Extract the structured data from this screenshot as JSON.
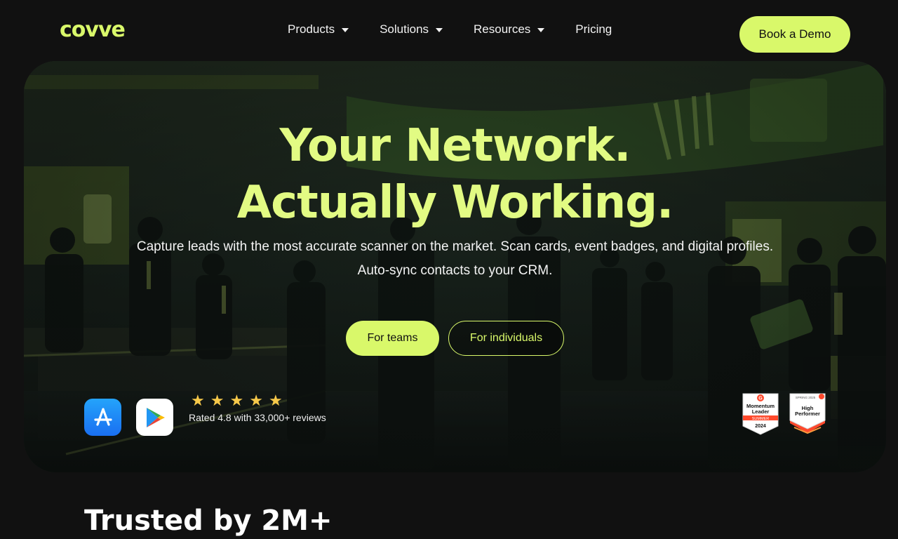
{
  "header": {
    "logo": "covve",
    "nav": [
      {
        "label": "Products",
        "has_dropdown": true
      },
      {
        "label": "Solutions",
        "has_dropdown": true
      },
      {
        "label": "Resources",
        "has_dropdown": true
      },
      {
        "label": "Pricing",
        "has_dropdown": false
      }
    ],
    "cta_label": "Book a Demo"
  },
  "hero": {
    "headline_line1": "Your Network.",
    "headline_line2": "Actually Working.",
    "subtext_line1": "Capture leads with the most accurate scanner on the market. Scan cards, event badges, and digital profiles.",
    "subtext_line2": "Auto-sync contacts to your CRM.",
    "primary_button": "For teams",
    "secondary_button": "For individuals",
    "stars": [
      "★",
      "★",
      "★",
      "★",
      "★"
    ],
    "rating_text": "Rated 4.8 with 33,000+ reviews",
    "badges": [
      {
        "line1": "Momentum",
        "line2": "Leader",
        "ribbon": "SUMMER",
        "year": "2024"
      },
      {
        "top": "SPRING 2025",
        "line1": "High",
        "line2": "Performer"
      }
    ],
    "icons": [
      "app-store-icon",
      "google-play-icon"
    ]
  },
  "trusted": {
    "heading": "Trusted by 2M+"
  },
  "colors": {
    "background": "#111111",
    "accent": "#d9f86a",
    "headline": "#e2fb83",
    "star": "#f7c94a",
    "g2_red": "#ff492c"
  }
}
